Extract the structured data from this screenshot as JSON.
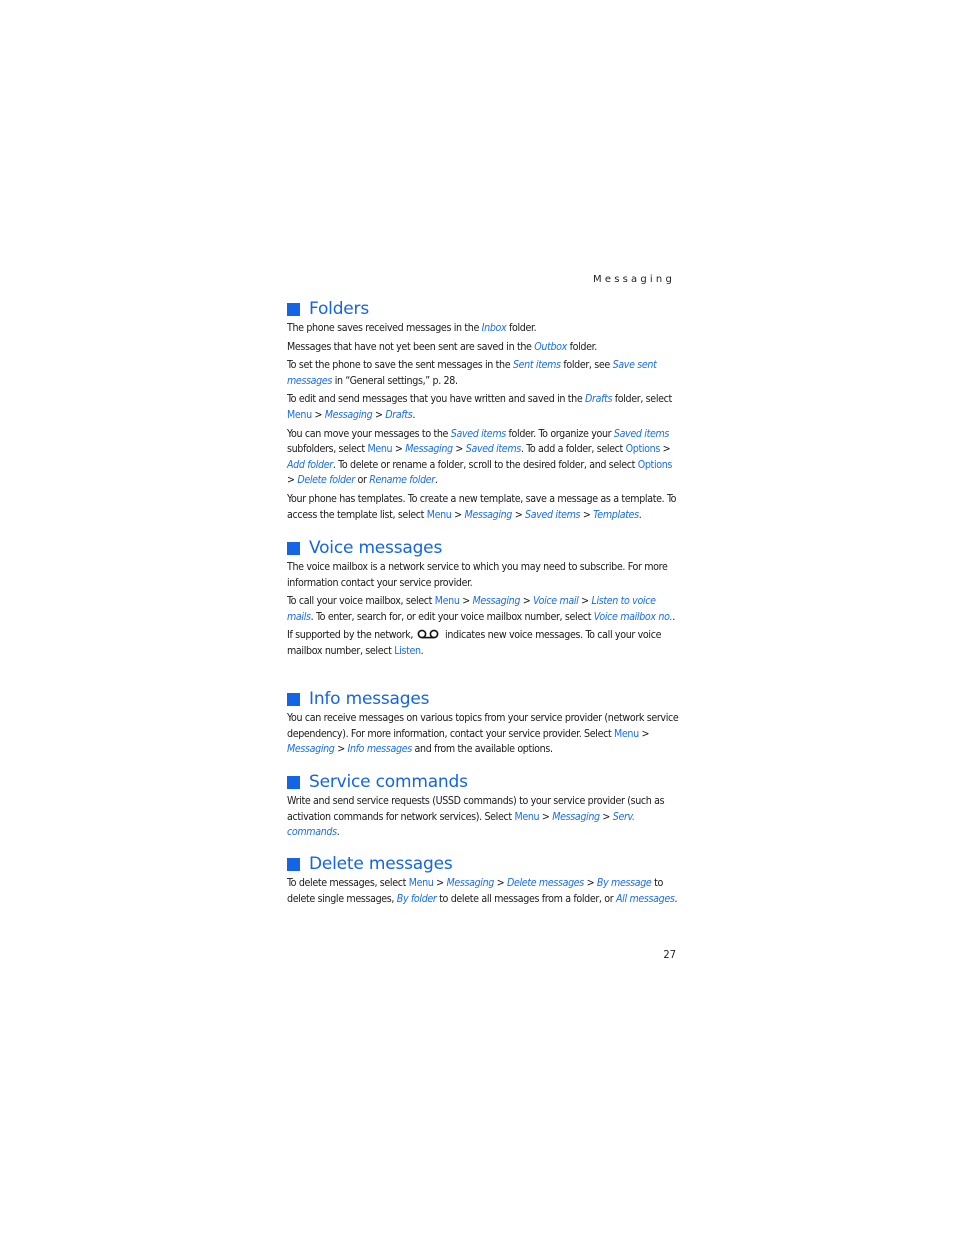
{
  "running_head": "Messaging",
  "page_number": "27",
  "colors": {
    "accent": "#1464e6",
    "link": "#1a6ee6",
    "text": "#1a1a1a"
  },
  "sections": {
    "folders": {
      "title": "Folders",
      "p1": {
        "a": "The phone saves received messages in the ",
        "l1": "Inbox",
        "b": " folder."
      },
      "p2": {
        "a": "Messages that have not yet been sent are saved in the ",
        "l1": "Outbox",
        "b": " folder."
      },
      "p3": {
        "a": "To set the phone to save the sent messages in the ",
        "l1": "Sent items",
        "b": " folder, see ",
        "l2": "Save sent messages",
        "c": " in “General settings,” p. 28."
      },
      "p4": {
        "a": "To edit and send messages that you have written and saved in the ",
        "l1": "Drafts",
        "b": " folder, select ",
        "m1": "Menu",
        "s1": " > ",
        "l2": "Messaging",
        "s2": " > ",
        "l3": "Drafts",
        "c": "."
      },
      "p5": {
        "a": "You can move your messages to the ",
        "l1": "Saved items",
        "b": " folder. To organize your ",
        "l2": "Saved items",
        "c": " subfolders, select ",
        "m1": "Menu",
        "s1": " > ",
        "l3": "Messaging",
        "s2": " > ",
        "l4": "Saved items",
        "d": ". To add a folder, select ",
        "m2": "Options",
        "s3": " > ",
        "l5": "Add folder",
        "e": ". To delete or rename a folder, scroll to the desired folder, and select ",
        "m3": "Options",
        "s4": " > ",
        "l6": "Delete folder",
        "f": " or ",
        "l7": "Rename folder",
        "g": "."
      },
      "p6": {
        "a": "Your phone has templates. To create a new template, save a message as a template. To access the template list, select ",
        "m1": "Menu",
        "s1": " > ",
        "l1": "Messaging",
        "s2": " > ",
        "l2": "Saved items",
        "s3": " > ",
        "l3": "Templates",
        "b": "."
      }
    },
    "voice": {
      "title": "Voice messages",
      "p1": {
        "a": "The voice mailbox is a network service to which you may need to subscribe. For more information contact your service provider."
      },
      "p2": {
        "a": "To call your voice mailbox, select ",
        "m1": "Menu",
        "s1": " > ",
        "l1": "Messaging",
        "s2": " > ",
        "l2": "Voice mail",
        "s3": " > ",
        "l3": "Listen to voice mails",
        "b": ". To enter, search for, or edit your voice mailbox number, select ",
        "l4": "Voice mailbox no.",
        "c": "."
      },
      "p3": {
        "a": "If supported by the network,",
        "icon": "voicemail-icon",
        "b": "indicates new voice messages. To call your voice mailbox number, select ",
        "m1": "Listen",
        "c": "."
      }
    },
    "info": {
      "title": "Info messages",
      "p1": {
        "a": "You can receive messages on various topics from your service provider (network service dependency). For more information, contact your service provider. Select ",
        "m1": "Menu",
        "s1": " > ",
        "l1": "Messaging",
        "s2": " > ",
        "l2": "Info messages",
        "b": " and from the available options."
      }
    },
    "service": {
      "title": "Service commands",
      "p1": {
        "a": "Write and send service requests (USSD commands) to your service provider (such as activation commands for network services). Select ",
        "m1": "Menu",
        "s1": " > ",
        "l1": "Messaging",
        "s2": " > ",
        "l2": "Serv. commands",
        "b": "."
      }
    },
    "delete": {
      "title": "Delete messages",
      "p1": {
        "a": "To delete messages, select ",
        "m1": "Menu",
        "s1": " > ",
        "l1": "Messaging",
        "s2": " > ",
        "l2": "Delete messages",
        "s3": " > ",
        "l3": "By message",
        "b": " to delete single messages, ",
        "l4": "By folder",
        "c": " to delete all messages from a folder, or ",
        "l5": "All messages",
        "d": "."
      }
    }
  }
}
